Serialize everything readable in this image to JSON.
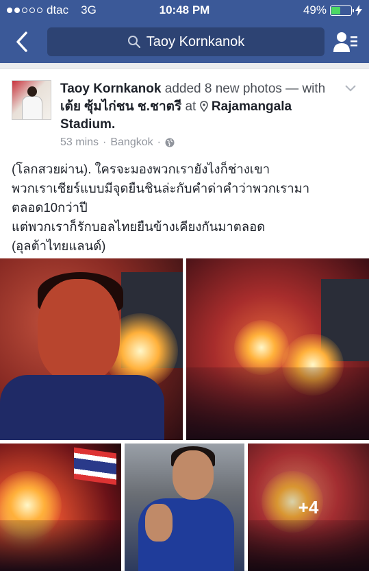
{
  "status_bar": {
    "carrier": "dtac",
    "network": "3G",
    "time": "10:48 PM",
    "battery": "49%",
    "battery_level": 0.49,
    "signal_bars_filled": 2,
    "signal_bars_total": 5
  },
  "nav": {
    "search_text": "Taoy Kornkanok",
    "icons": [
      "back-chevron-icon",
      "search-icon",
      "friend-list-icon"
    ]
  },
  "post": {
    "author": "Taoy Kornkanok",
    "action": " added 8 new photos — with ",
    "tagged": "เต้ย ซุ้มไก่ชน ช.ชาตรี",
    "at_word": " at ",
    "location": "Rajamangala Stadium.",
    "time_ago": "53 mins",
    "separator": "·",
    "place": "Bangkok",
    "text": "(โลกสวยผ่าน). ใครจะมองพวกเรายังไงก็ช่างเขา\nพวกเราเชียร์แบบมีจุดยืนชินล่ะกับคำด่าคำว่าพวกเรามา\nตลอด10กว่าปี\nแต่พวกเราก็รักบอลไทยยืนข้างเคียงกันมาตลอด\n(อุลต้าไทยแลนด์)",
    "more_photos": "+4"
  },
  "colors": {
    "brand": "#3b5998",
    "search_bg": "#2d4373",
    "meta_text": "#90949c"
  }
}
